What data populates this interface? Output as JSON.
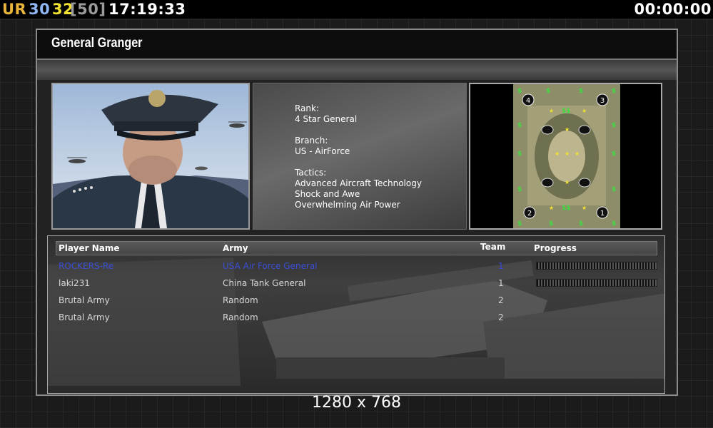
{
  "hud": {
    "ur_label": "UR",
    "value_a": "30",
    "value_b": "32",
    "value_c": "[50]",
    "clock": "17:19:33",
    "timer": "00:00:00"
  },
  "general": {
    "title": "General Granger",
    "rank_label": "Rank:",
    "rank_value": "4 Star General",
    "branch_label": "Branch:",
    "branch_value": "US - AirForce",
    "tactics_label": "Tactics:",
    "tactics": [
      "Advanced Aircraft Technology",
      "Shock and Awe",
      "Overwhelming Air Power"
    ]
  },
  "map": {
    "start_positions": [
      "4",
      "3",
      "2",
      "1"
    ]
  },
  "table": {
    "headers": {
      "player": "Player Name",
      "army": "Army",
      "team": "Team",
      "progress": "Progress"
    },
    "rows": [
      {
        "player": "ROCKERS-Re",
        "army": "USA Air Force General",
        "team": "1",
        "progress": 1.0
      },
      {
        "player": "laki231",
        "army": "China Tank General",
        "team": "1",
        "progress": 1.0
      },
      {
        "player": "Brutal Army",
        "army": "Random",
        "team": "2"
      },
      {
        "player": "Brutal Army",
        "army": "Random",
        "team": "2"
      }
    ]
  },
  "resolution": "1280 x 768",
  "colors": {
    "ur": "#e7b33c",
    "value_a": "#8fb5f2",
    "value_b": "#f1e232",
    "local_player": "#3a4fd6"
  }
}
